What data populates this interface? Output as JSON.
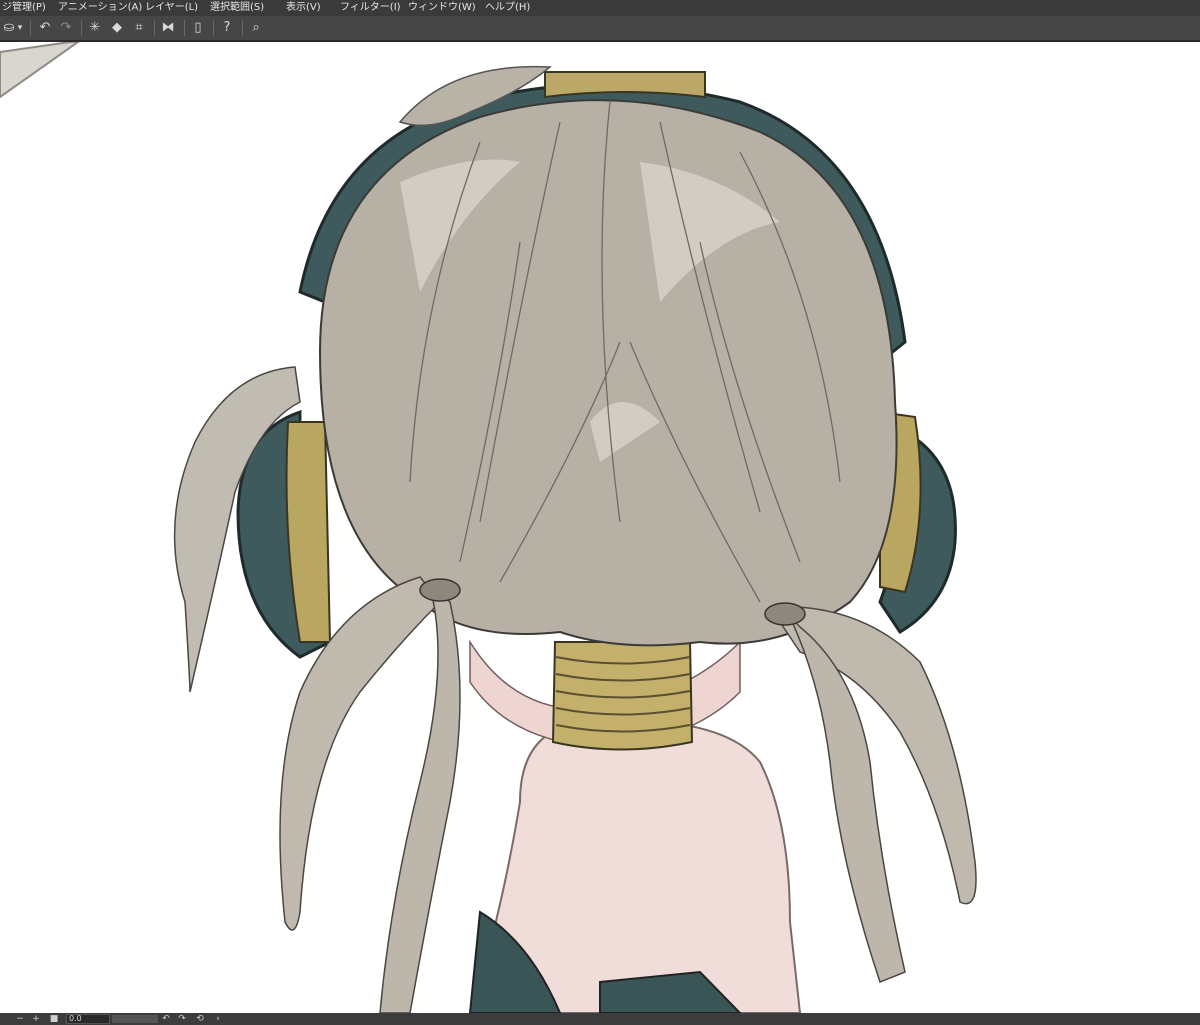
{
  "menubar": {
    "items": [
      {
        "label": "ジ管理(P)"
      },
      {
        "label": "アニメーション(A)"
      },
      {
        "label": "レイヤー(L)"
      },
      {
        "label": "選択範囲(S)"
      },
      {
        "label": "表示(V)"
      },
      {
        "label": "フィルター(I)"
      },
      {
        "label": "ウィンドウ(W)"
      },
      {
        "label": "ヘルプ(H)"
      }
    ]
  },
  "toolbar": {
    "icons": [
      "stamp-icon",
      "chevron-down-icon",
      "undo-icon",
      "redo-icon",
      "deselect-icon",
      "fill-icon",
      "transform-icon",
      "flip-icon",
      "device-icon",
      "help-icon",
      "search-icon"
    ]
  },
  "statusbar": {
    "minus": "−",
    "plus": "+",
    "square": "■",
    "value": "0.0",
    "rotate_left": "↶",
    "rotate_right": "↷",
    "reset": "⟲",
    "prev": "‹"
  },
  "colors": {
    "menubar_bg": "#3a3a3a",
    "toolbar_bg": "#464646",
    "hair": "#b3ada2",
    "headphone": "#3f5a5c",
    "gold": "#b8a661",
    "skin": "#efd9d6",
    "dress": "#3a5556"
  }
}
